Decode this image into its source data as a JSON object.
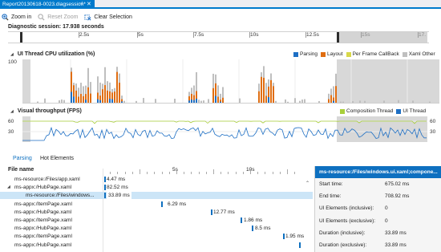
{
  "tab": {
    "title": "Report20130618-0023.diagsession*",
    "pin_icon": "pin-icon",
    "close_icon": "close-icon"
  },
  "toolbar": {
    "zoom_in": "Zoom in",
    "reset_zoom": "Reset Zoom",
    "clear_selection": "Clear Selection"
  },
  "session": {
    "label": "Diagnostic session: 17.938 seconds",
    "ticks": [
      "2.5s",
      "5s",
      "7.5s",
      "10s",
      "12.5s",
      "15s",
      "17."
    ]
  },
  "cpu": {
    "title": "UI Thread CPU utilization (%)",
    "y_top": "100",
    "legend": [
      {
        "label": "Parsing",
        "color": "#1e6fc4"
      },
      {
        "label": "Layout",
        "color": "#e06d10"
      },
      {
        "label": "Per Frame CallBack",
        "color": "#d8d84a"
      },
      {
        "label": "Xaml Other",
        "color": "#bfbfbf"
      }
    ]
  },
  "fps": {
    "title": "Visual throughput (FPS)",
    "y_top": "60",
    "y_mid": "30",
    "legend": [
      {
        "label": "Composition Thread",
        "color": "#a9cf3a"
      },
      {
        "label": "UI Thread",
        "color": "#1e6fc4"
      }
    ]
  },
  "subtabs": {
    "parsing": "Parsing",
    "hot": "Hot Elements"
  },
  "tree": {
    "header": "File name",
    "timeline_ticks": [
      "5s",
      "10s"
    ],
    "rows": [
      {
        "name": "ms-resource:/Files/app.xaml",
        "duration": "4.47 ms",
        "indent": 0,
        "expanded": false,
        "has_children": false,
        "selected": false,
        "start_fraction": 0.0
      },
      {
        "name": "ms-appx:/HubPage.xaml",
        "duration": "82.52 ms",
        "indent": 0,
        "expanded": true,
        "has_children": true,
        "selected": false,
        "start_fraction": 0.0
      },
      {
        "name": "ms-resource:/Files/windows...",
        "duration": "33.89 ms",
        "indent": 1,
        "expanded": false,
        "has_children": false,
        "selected": true,
        "start_fraction": 0.0
      },
      {
        "name": "ms-appx:/ItemPage.xaml",
        "duration": "6.29 ms",
        "indent": 0,
        "expanded": false,
        "has_children": false,
        "selected": false,
        "start_fraction": 0.3
      },
      {
        "name": "ms-appx:/HubPage.xaml",
        "duration": "12.77 ms",
        "indent": 0,
        "expanded": false,
        "has_children": false,
        "selected": false,
        "start_fraction": 0.44
      },
      {
        "name": "ms-appx:/ItemPage.xaml",
        "duration": "1.86 ms",
        "indent": 0,
        "expanded": false,
        "has_children": false,
        "selected": false,
        "start_fraction": 0.69
      },
      {
        "name": "ms-appx:/HubPage.xaml",
        "duration": "8.5 ms",
        "indent": 0,
        "expanded": false,
        "has_children": false,
        "selected": false,
        "start_fraction": 0.75
      },
      {
        "name": "ms-appx:/ItemPage.xaml",
        "duration": "1.95 ms",
        "indent": 0,
        "expanded": false,
        "has_children": false,
        "selected": false,
        "start_fraction": 0.91
      },
      {
        "name": "ms-appx:/HubPage.xaml",
        "duration": "",
        "indent": 0,
        "expanded": false,
        "has_children": false,
        "selected": false,
        "start_fraction": 0.99
      }
    ]
  },
  "details": {
    "title": "ms-resource:/Files/windows.ui.xaml;compone...",
    "rows": [
      {
        "key": "Start time:",
        "value": "675.02 ms"
      },
      {
        "key": "End time:",
        "value": "708.92 ms"
      },
      {
        "key": "UI Elements (inclusive):",
        "value": "0"
      },
      {
        "key": "UI Elements (exclusive):",
        "value": "0"
      },
      {
        "key": "Duration (inclusive):",
        "value": "33.89 ms"
      },
      {
        "key": "Duration (exclusive):",
        "value": "33.89 ms"
      }
    ]
  }
}
